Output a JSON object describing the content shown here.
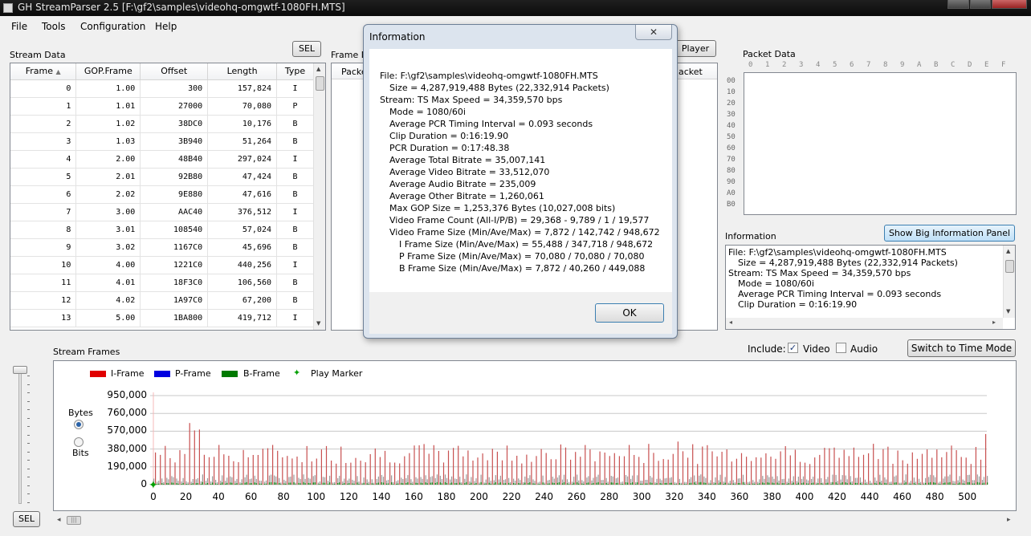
{
  "window": {
    "title": "GH StreamParser 2.5 [F:\\gf2\\samples\\videohq-omgwtf-1080FH.MTS]"
  },
  "menu": [
    "File",
    "Tools",
    "Configuration",
    "Help"
  ],
  "stream_data": {
    "label": "Stream Data",
    "sel_label": "SEL",
    "columns": [
      "Frame",
      "GOP.Frame",
      "Offset",
      "Length",
      "Type"
    ],
    "rows": [
      [
        "0",
        "1.00",
        "300",
        "157,824",
        "I"
      ],
      [
        "1",
        "1.01",
        "27000",
        "70,080",
        "P"
      ],
      [
        "2",
        "1.02",
        "38DC0",
        "10,176",
        "B"
      ],
      [
        "3",
        "1.03",
        "3B940",
        "51,264",
        "B"
      ],
      [
        "4",
        "2.00",
        "48B40",
        "297,024",
        "I"
      ],
      [
        "5",
        "2.01",
        "92B80",
        "47,424",
        "B"
      ],
      [
        "6",
        "2.02",
        "9E880",
        "47,616",
        "B"
      ],
      [
        "7",
        "3.00",
        "AAC40",
        "376,512",
        "I"
      ],
      [
        "8",
        "3.01",
        "108540",
        "57,024",
        "B"
      ],
      [
        "9",
        "3.02",
        "1167C0",
        "45,696",
        "B"
      ],
      [
        "10",
        "4.00",
        "1221C0",
        "440,256",
        "I"
      ],
      [
        "11",
        "4.01",
        "18F3C0",
        "106,560",
        "B"
      ],
      [
        "12",
        "4.02",
        "1A97C0",
        "67,200",
        "B"
      ],
      [
        "13",
        "5.00",
        "1BA800",
        "419,712",
        "I"
      ]
    ]
  },
  "frame_data": {
    "label": "Frame Da",
    "col_left": "Packe",
    "col_right": "acket",
    "player_button": "Player"
  },
  "packet_data": {
    "label": "Packet Data",
    "hex_columns": [
      "0",
      "1",
      "2",
      "3",
      "4",
      "5",
      "6",
      "7",
      "8",
      "9",
      "A",
      "B",
      "C",
      "D",
      "E",
      "F"
    ],
    "row_labels": [
      "00",
      "10",
      "20",
      "30",
      "40",
      "50",
      "60",
      "70",
      "80",
      "90",
      "A0",
      "B0"
    ]
  },
  "information_panel": {
    "label": "Information",
    "big_button": "Show Big Information Panel",
    "lines": [
      "File: F:\\gf2\\samples\\videohq-omgwtf-1080FH.MTS",
      "Size = 4,287,919,488 Bytes (22,332,914 Packets)",
      "Stream: TS Max Speed = 34,359,570 bps",
      "Mode = 1080/60i",
      "Average PCR Timing Interval = 0.093 seconds",
      "Clip Duration = 0:16:19.90"
    ]
  },
  "dialog": {
    "title": "Information",
    "close_glyph": "✕",
    "ok_label": "OK",
    "lines": [
      "File: F:\\gf2\\samples\\videohq-omgwtf-1080FH.MTS",
      "Size = 4,287,919,488 Bytes (22,332,914 Packets)",
      "Stream: TS Max Speed = 34,359,570 bps",
      "Mode = 1080/60i",
      "Average PCR Timing Interval = 0.093 seconds",
      "Clip Duration = 0:16:19.90",
      "PCR Duration = 0:17:48.38",
      "Average Total Bitrate = 35,007,141",
      "Average Video Bitrate = 33,512,070",
      "Average Audio Bitrate = 235,009",
      "Average Other Bitrate = 1,260,061",
      "Max GOP Size = 1,253,376 Bytes (10,027,008 bits)",
      "Video Frame Count (All-I/P/B) = 29,368 - 9,789 / 1 / 19,577",
      "Video Frame Size (Min/Ave/Max) = 7,872 / 142,742 / 948,672",
      "I Frame Size (Min/Ave/Max) = 55,488 / 347,718 / 948,672",
      "P Frame Size (Min/Ave/Max) = 70,080 / 70,080 / 70,080",
      "B Frame Size (Min/Ave/Max) = 7,872 / 40,260 / 449,088"
    ]
  },
  "include": {
    "label": "Include:",
    "video_label": "Video",
    "video_checked": true,
    "audio_label": "Audio",
    "audio_checked": false,
    "switch_button": "Switch to Time Mode"
  },
  "stream_frames": {
    "label": "Stream Frames",
    "bytes_label": "Bytes",
    "bits_label": "Bits",
    "bytes_selected": true,
    "sel_label": "SEL"
  },
  "colors": {
    "i_frame": "#e00000",
    "p_frame": "#0000e0",
    "b_frame": "#007a00",
    "marker": "#00a000"
  },
  "chart_data": {
    "type": "bar",
    "legend": [
      "I-Frame",
      "P-Frame",
      "B-Frame",
      "Play Marker"
    ],
    "ylim": [
      0,
      950000
    ],
    "yticks": [
      "950,000",
      "760,000",
      "570,000",
      "380,000",
      "190,000",
      "0"
    ],
    "ytick_values": [
      950000,
      760000,
      570000,
      380000,
      190000,
      0
    ],
    "xlim": [
      0,
      512
    ],
    "xticks": [
      "0",
      "20",
      "40",
      "60",
      "80",
      "100",
      "120",
      "140",
      "160",
      "180",
      "200",
      "220",
      "240",
      "260",
      "280",
      "300",
      "320",
      "340",
      "360",
      "380",
      "400",
      "420",
      "440",
      "460",
      "480",
      "500"
    ],
    "xtick_values": [
      0,
      20,
      40,
      60,
      80,
      100,
      120,
      140,
      160,
      180,
      200,
      220,
      240,
      260,
      280,
      300,
      320,
      340,
      360,
      380,
      400,
      420,
      440,
      460,
      480,
      500
    ],
    "play_marker_x": 0
  }
}
